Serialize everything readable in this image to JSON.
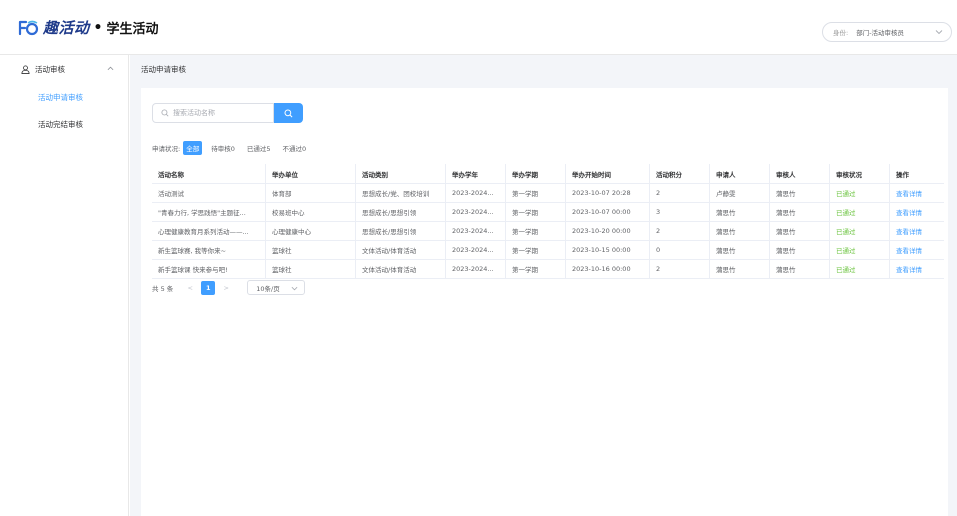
{
  "header": {
    "logo_text": "趣活动",
    "logo_dot": "•",
    "logo_sub": "学生活动",
    "identity_label": "身份:",
    "identity_value": "部门-活动审核员"
  },
  "sidebar": {
    "group_label": "活动审核",
    "items": [
      {
        "label": "活动申请审核",
        "active": true
      },
      {
        "label": "活动完结审核",
        "active": false
      }
    ]
  },
  "content": {
    "breadcrumb": "活动申请审核",
    "search": {
      "placeholder": "搜索活动名称"
    },
    "status": {
      "label": "申请状况:",
      "chips": [
        "全部",
        "待审核0",
        "已通过5",
        "不通过0"
      ]
    },
    "table": {
      "headers": [
        "活动名称",
        "举办单位",
        "活动类别",
        "举办学年",
        "举办学期",
        "举办开始时间",
        "活动积分",
        "申请人",
        "审核人",
        "审核状况",
        "操作"
      ],
      "rows": [
        [
          "活动测试",
          "体育部",
          "思想成长/党、团校培训",
          "2023-2024...",
          "第一学期",
          "2023-10-07 20:28",
          "2",
          "卢静雯",
          "蒲思竹",
          "已通过",
          "查看详情"
        ],
        [
          "\"青春力行, 学思践悟\"主题征...",
          "校易班中心",
          "思想成长/思想引领",
          "2023-2024...",
          "第一学期",
          "2023-10-07 00:00",
          "3",
          "蒲思竹",
          "蒲思竹",
          "已通过",
          "查看详情"
        ],
        [
          "心理健康教育月系列活动——...",
          "心理健康中心",
          "思想成长/思想引领",
          "2023-2024...",
          "第一学期",
          "2023-10-20 00:00",
          "2",
          "蒲思竹",
          "蒲思竹",
          "已通过",
          "查看详情"
        ],
        [
          "新生篮球赛, 我等你来~",
          "篮球社",
          "文体活动/体育活动",
          "2023-2024...",
          "第一学期",
          "2023-10-15 00:00",
          "0",
          "蒲思竹",
          "蒲思竹",
          "已通过",
          "查看详情"
        ],
        [
          "新手篮球课 快来参与吧!",
          "篮球社",
          "文体活动/体育活动",
          "2023-2024...",
          "第一学期",
          "2023-10-16 00:00",
          "2",
          "蒲思竹",
          "蒲思竹",
          "已通过",
          "查看详情"
        ]
      ]
    },
    "pager": {
      "total": "共 5 条",
      "prev": "<",
      "current": "1",
      "next": ">",
      "page_size": "10条/页"
    }
  },
  "colors": {
    "accent": "#409eff",
    "success": "#67c23a",
    "brand": "#1e3a8a"
  }
}
